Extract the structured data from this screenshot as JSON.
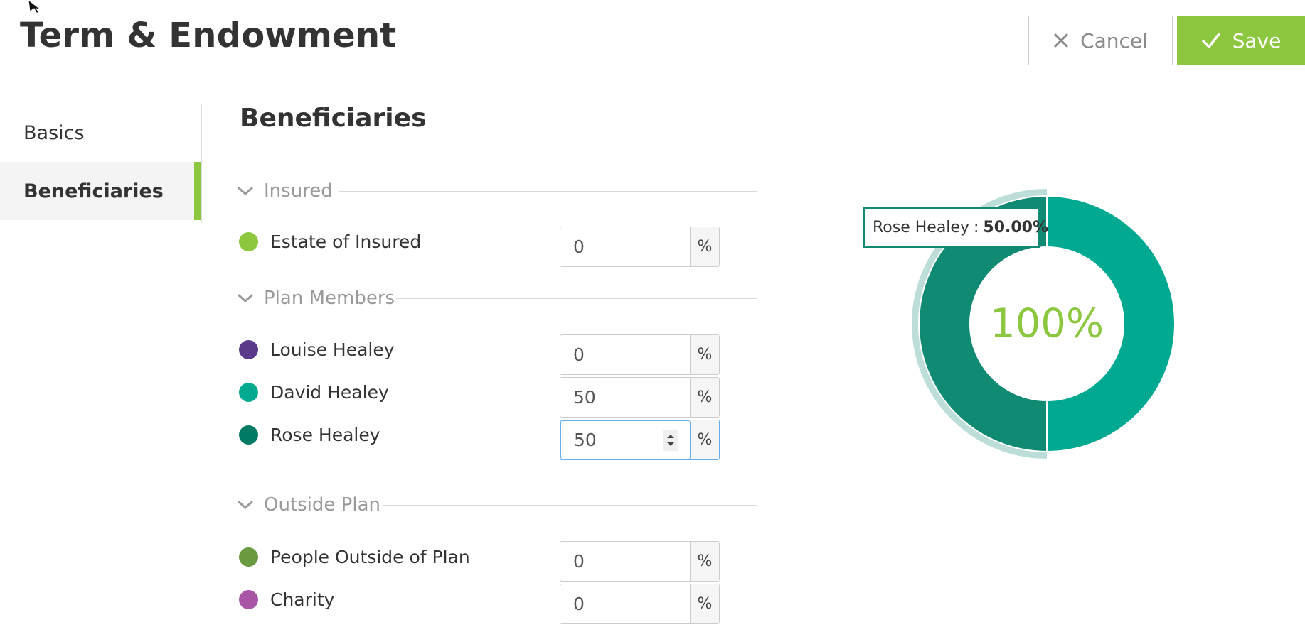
{
  "page": {
    "title": "Term & Endowment"
  },
  "actions": {
    "cancel_label": "Cancel",
    "save_label": "Save"
  },
  "sidebar": {
    "items": [
      {
        "label": "Basics"
      },
      {
        "label": "Beneficiaries"
      }
    ]
  },
  "section": {
    "title": "Beneficiaries"
  },
  "groups": [
    {
      "label": "Insured"
    },
    {
      "label": "Plan Members"
    },
    {
      "label": "Outside Plan"
    }
  ],
  "beneficiaries": [
    {
      "name": "Estate of Insured",
      "value": "0",
      "color": "#8dc63f"
    },
    {
      "name": "Louise Healey",
      "value": "0",
      "color": "#5b3a8c"
    },
    {
      "name": "David Healey",
      "value": "50",
      "color": "#00a98f"
    },
    {
      "name": "Rose Healey",
      "value": "50",
      "color": "#007a63"
    },
    {
      "name": "People Outside of Plan",
      "value": "0",
      "color": "#6a9a3f"
    },
    {
      "name": "Charity",
      "value": "0",
      "color": "#a855a6"
    }
  ],
  "percent_symbol": "%",
  "chart_data": {
    "type": "pie",
    "variant": "donut",
    "center_label": "100%",
    "slices": [
      {
        "name": "David Healey",
        "value": 50,
        "color": "#00a98f"
      },
      {
        "name": "Rose Healey",
        "value": 50,
        "color": "#118a74",
        "highlighted": true
      }
    ],
    "tooltip": {
      "name": "Rose Healey",
      "separator": ":",
      "value": "50.00%"
    },
    "center_label_color": "#8dc63f"
  }
}
